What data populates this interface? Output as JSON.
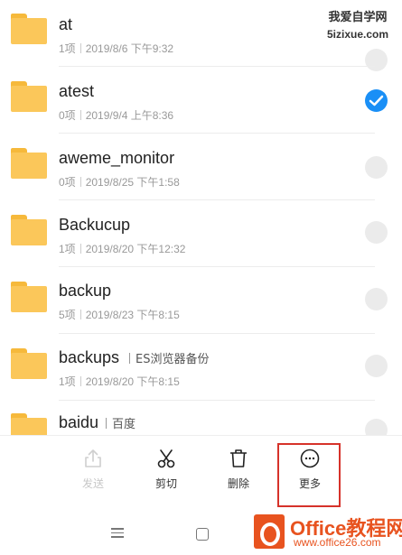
{
  "watermark": {
    "line1": "我爱自学网",
    "line2": "5izixue.com"
  },
  "files": [
    {
      "name": "at",
      "count": "1项",
      "date": "2019/8/6 下午9:32",
      "selected": false
    },
    {
      "name": "atest",
      "count": "0项",
      "date": "2019/9/4 上午8:36",
      "selected": true
    },
    {
      "name": "aweme_monitor",
      "count": "0项",
      "date": "2019/8/25 下午1:58",
      "selected": false
    },
    {
      "name": "Backucup",
      "count": "1项",
      "date": "2019/8/20 下午12:32",
      "selected": false
    },
    {
      "name": "backup",
      "count": "5项",
      "date": "2019/8/23 下午8:15",
      "selected": false
    },
    {
      "name": "backups",
      "tag": "ES浏览器备份",
      "count": "1项",
      "date": "2019/8/20 下午8:15",
      "selected": false
    },
    {
      "name": "baidu",
      "tag": "百度",
      "count": "",
      "date": "",
      "selected": false
    }
  ],
  "toolbar": {
    "send": "发送",
    "cut": "剪切",
    "delete": "删除",
    "more": "更多"
  },
  "logo": {
    "title": "Office教程网",
    "url": "www.office26.com"
  },
  "colors": {
    "accent": "#1a8ff6",
    "folder": "#fbc75a",
    "highlight": "#d6322a",
    "logo": "#e8531f"
  }
}
